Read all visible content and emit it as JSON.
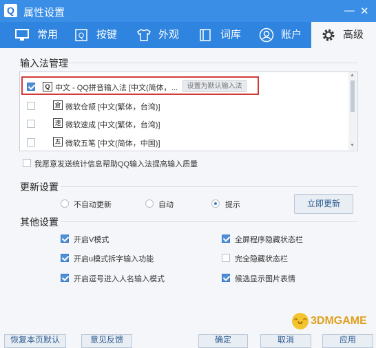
{
  "window": {
    "logo_text": "Q",
    "title": "属性设置",
    "minimize_icon": "minimize-icon",
    "close_icon": "close-icon"
  },
  "tabs": [
    {
      "label": "常用",
      "icon": "monitor-icon",
      "active": false
    },
    {
      "label": "按键",
      "icon": "q-key-icon",
      "active": false
    },
    {
      "label": "外观",
      "icon": "shirt-icon",
      "active": false
    },
    {
      "label": "词库",
      "icon": "book-icon",
      "active": false
    },
    {
      "label": "账户",
      "icon": "user-icon",
      "active": false
    },
    {
      "label": "高级",
      "icon": "gear-icon",
      "active": true
    }
  ],
  "ime_manage": {
    "title": "输入法管理",
    "set_default_label": "设置为默认输入法",
    "items": [
      {
        "icon_text": "Q",
        "name": "中文 - QQ拼音输入法 [中文(简体，...",
        "checked": true
      },
      {
        "icon_text": "倉",
        "name": "微软仓颉 [中文(繁体，台湾)]",
        "checked": false
      },
      {
        "icon_text": "速",
        "name": "微软速成 [中文(繁体，台湾)]",
        "checked": false
      },
      {
        "icon_text": "五",
        "name": "微软五笔 [中文(简体，中国)]",
        "checked": false
      }
    ],
    "stats_label": "我愿意发送统计信息帮助QQ输入法提高输入质量",
    "stats_checked": false
  },
  "update": {
    "title": "更新设置",
    "options": [
      {
        "label": "不自动更新",
        "selected": false
      },
      {
        "label": "自动",
        "selected": false
      },
      {
        "label": "提示",
        "selected": true
      }
    ],
    "update_now_label": "立即更新"
  },
  "other": {
    "title": "其他设置",
    "options": [
      {
        "label": "开启V模式",
        "checked": true
      },
      {
        "label": "全屏程序隐藏状态栏",
        "checked": true
      },
      {
        "label": "开启u模式拆字输入功能",
        "checked": true
      },
      {
        "label": "完全隐藏状态栏",
        "checked": false
      },
      {
        "label": "开启逗号进入人名输入模式",
        "checked": true
      },
      {
        "label": "候选显示图片表情",
        "checked": true
      }
    ]
  },
  "footer": {
    "buttons": [
      "恢复本页默认",
      "意见反馈",
      "确定",
      "取消",
      "应用"
    ],
    "watermark": "3DMGAME"
  }
}
